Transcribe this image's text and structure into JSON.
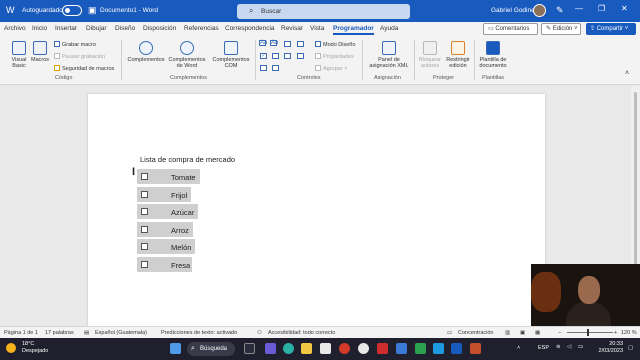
{
  "titlebar": {
    "autosave_label": "Autoguardado",
    "doc_title": "Documento1 - Word",
    "search_placeholder": "Buscar",
    "user_name": "Gabriel Godinez",
    "minimize": "—",
    "restore": "❐",
    "close": "✕"
  },
  "menu": {
    "tabs": [
      "Archivo",
      "Inicio",
      "Insertar",
      "Dibujar",
      "Diseño",
      "Disposición",
      "Referencias",
      "Correspondencia",
      "Revisar",
      "Vista",
      "Programador",
      "Ayuda"
    ],
    "active_tab": "Programador",
    "comments_label": "Comentarios",
    "edit_label": "Edición",
    "share_label": "Compartir"
  },
  "ribbon": {
    "codigo": {
      "visual_basic": "Visual Basic",
      "macros": "Macros",
      "grabar_macro": "Grabar macro",
      "pausar_grabacion": "Pausar grabación",
      "seguridad_macros": "Seguridad de macros",
      "label": "Código"
    },
    "complementos": {
      "complementos": "Complementos",
      "complementos_word": "Complementos de Word",
      "complementos_com": "Complementos COM",
      "label": "Complementos"
    },
    "controles": {
      "aa1": "Aa",
      "aa2": "Aa",
      "modo_diseno": "Modo Diseño",
      "propiedades": "Propiedades",
      "agrupar": "Agrupar",
      "label": "Controles"
    },
    "asignacion": {
      "panel_xml": "Panel de asignación XML",
      "label": "Asignación"
    },
    "proteger": {
      "bloquear_autores": "Bloquear autores",
      "restringir_edicion": "Restringir edición",
      "label": "Proteger"
    },
    "plantillas": {
      "plantilla_documento": "Plantilla de documento",
      "label": "Plantillas"
    }
  },
  "document": {
    "heading": "Lista de compra de mercado",
    "items": [
      "Tomate",
      "Frijol",
      "Azúcar",
      "Arroz",
      "Melón",
      "Fresa"
    ]
  },
  "statusbar": {
    "page": "Página 1 de 1",
    "words": "17 palabras",
    "language": "Español (Guatemala)",
    "predictions": "Predicciones de texto: activado",
    "accessibility": "Accesibilidad: todo correcto",
    "focus": "Concentración",
    "zoom": "120 %"
  },
  "taskbar": {
    "temp": "18°C",
    "weather": "Despejado",
    "search": "Búsqueda",
    "lang": "ESP",
    "time": "20:33",
    "date": "2/03/2023"
  },
  "colors": {
    "word_blue": "#185abd",
    "taskbar": "#1f1f2e"
  }
}
